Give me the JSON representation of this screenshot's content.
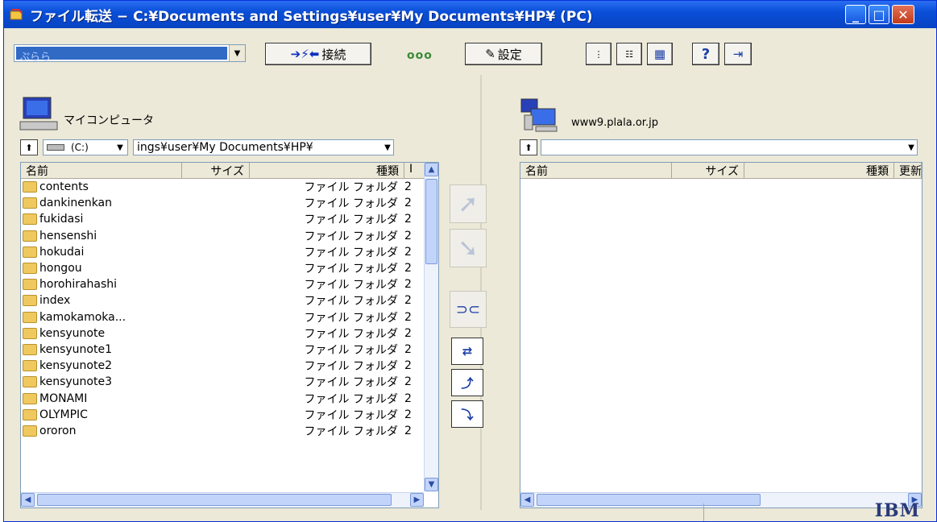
{
  "window": {
    "title": "ファイル転送 − C:¥Documents and Settings¥user¥My Documents¥HP¥ (PC)"
  },
  "toolbar": {
    "profile_value": "ぷらら",
    "connect_label": "接続",
    "settings_label": "設定"
  },
  "left": {
    "header": "マイコンピュータ",
    "drive": "(C:)",
    "path": "ings¥user¥My Documents¥HP¥",
    "columns": [
      "名前",
      "サイズ",
      "種類",
      "I"
    ],
    "rows": [
      {
        "name": "contents",
        "type": "ファイル フォルダ",
        "date": "2"
      },
      {
        "name": "dankinenkan",
        "type": "ファイル フォルダ",
        "date": "2"
      },
      {
        "name": "fukidasi",
        "type": "ファイル フォルダ",
        "date": "2"
      },
      {
        "name": "hensenshi",
        "type": "ファイル フォルダ",
        "date": "2"
      },
      {
        "name": "hokudai",
        "type": "ファイル フォルダ",
        "date": "2"
      },
      {
        "name": "hongou",
        "type": "ファイル フォルダ",
        "date": "2"
      },
      {
        "name": "horohirahashi",
        "type": "ファイル フォルダ",
        "date": "2"
      },
      {
        "name": "index",
        "type": "ファイル フォルダ",
        "date": "2"
      },
      {
        "name": "kamokamoka...",
        "type": "ファイル フォルダ",
        "date": "2"
      },
      {
        "name": "kensyunote",
        "type": "ファイル フォルダ",
        "date": "2"
      },
      {
        "name": "kensyunote1",
        "type": "ファイル フォルダ",
        "date": "2"
      },
      {
        "name": "kensyunote2",
        "type": "ファイル フォルダ",
        "date": "2"
      },
      {
        "name": "kensyunote3",
        "type": "ファイル フォルダ",
        "date": "2"
      },
      {
        "name": "MONAMI",
        "type": "ファイル フォルダ",
        "date": "2"
      },
      {
        "name": "OLYMPIC",
        "type": "ファイル フォルダ",
        "date": "2"
      },
      {
        "name": "ororon",
        "type": "ファイル フォルダ",
        "date": "2"
      }
    ]
  },
  "right": {
    "header": "www9.plala.or.jp",
    "path": "",
    "columns": [
      "名前",
      "サイズ",
      "種類",
      "更新"
    ]
  },
  "status": {
    "brand": "IBM"
  }
}
